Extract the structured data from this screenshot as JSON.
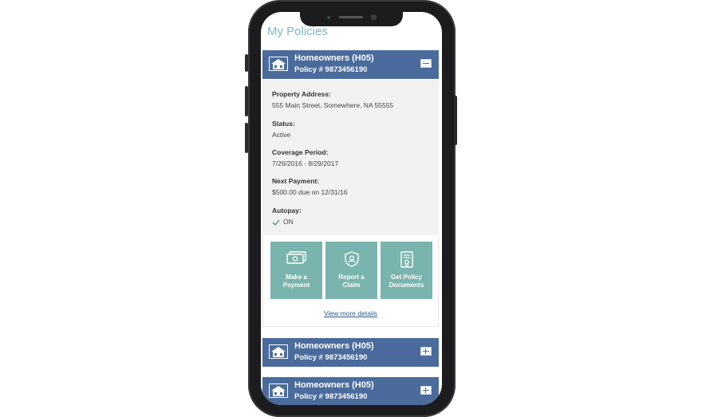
{
  "page": {
    "title": "My Policies"
  },
  "policies": [
    {
      "title": "Homeowners (H05)",
      "number": "Policy # 9873456190",
      "expanded": true
    },
    {
      "title": "Homeowners (H05)",
      "number": "Policy # 9873456190",
      "expanded": false
    },
    {
      "title": "Homeowners (H05)",
      "number": "Policy # 9873456190",
      "expanded": false
    }
  ],
  "details": {
    "address_label": "Property Address:",
    "address_value": "555 Main Street, Somewhere, NA 55555",
    "status_label": "Status:",
    "status_value": "Active",
    "coverage_label": "Coverage Period:",
    "coverage_value": "7/26/2016 - 8/29/2017",
    "payment_label": "Next Payment:",
    "payment_value": "$500.00 due on 12/31/16",
    "autopay_label": "Autopay:",
    "autopay_value": "ON"
  },
  "actions": [
    {
      "label": "Make a\nPayment",
      "icon": "money-icon"
    },
    {
      "label": "Report a\nClaim",
      "icon": "shield-icon"
    },
    {
      "label": "Get Policy\nDocuments",
      "icon": "document-icon"
    }
  ],
  "view_more": "View more details",
  "colors": {
    "header": "#4a6b9c",
    "tile": "#7ab4ae",
    "title": "#7fb8c4",
    "link": "#2a5a8c"
  }
}
